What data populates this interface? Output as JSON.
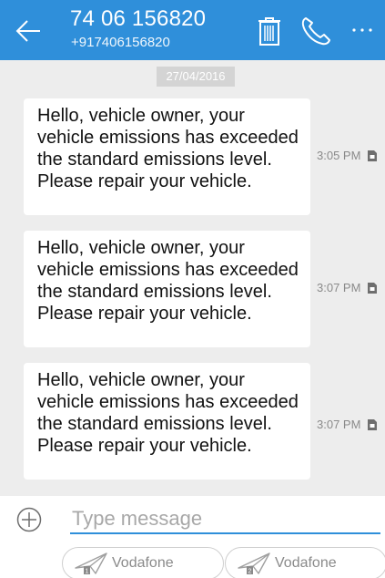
{
  "header": {
    "title": "74 06 156820",
    "subtitle": "+917406156820",
    "background": "#2F8FDA",
    "icons": [
      "back-arrow-icon",
      "trash-icon",
      "phone-icon",
      "more-icon"
    ]
  },
  "conversation": {
    "date": "27/04/2016",
    "messages": [
      {
        "text": "Hello, vehicle owner, your vehicle emissions has exceeded the standard emissions level. Please repair your vehicle.",
        "time": "3:05 PM"
      },
      {
        "text": "Hello, vehicle owner, your vehicle emissions has exceeded the standard emissions level. Please repair your vehicle.",
        "time": "3:07 PM"
      },
      {
        "text": "Hello, vehicle owner, your vehicle emissions has exceeded the standard emissions level. Please repair your vehicle.",
        "time": "3:07 PM"
      }
    ]
  },
  "composer": {
    "placeholder": "Type message",
    "sim_buttons": [
      {
        "label": "Vodafone",
        "sim": "1"
      },
      {
        "label": "Vodafone",
        "sim": "2"
      }
    ]
  }
}
